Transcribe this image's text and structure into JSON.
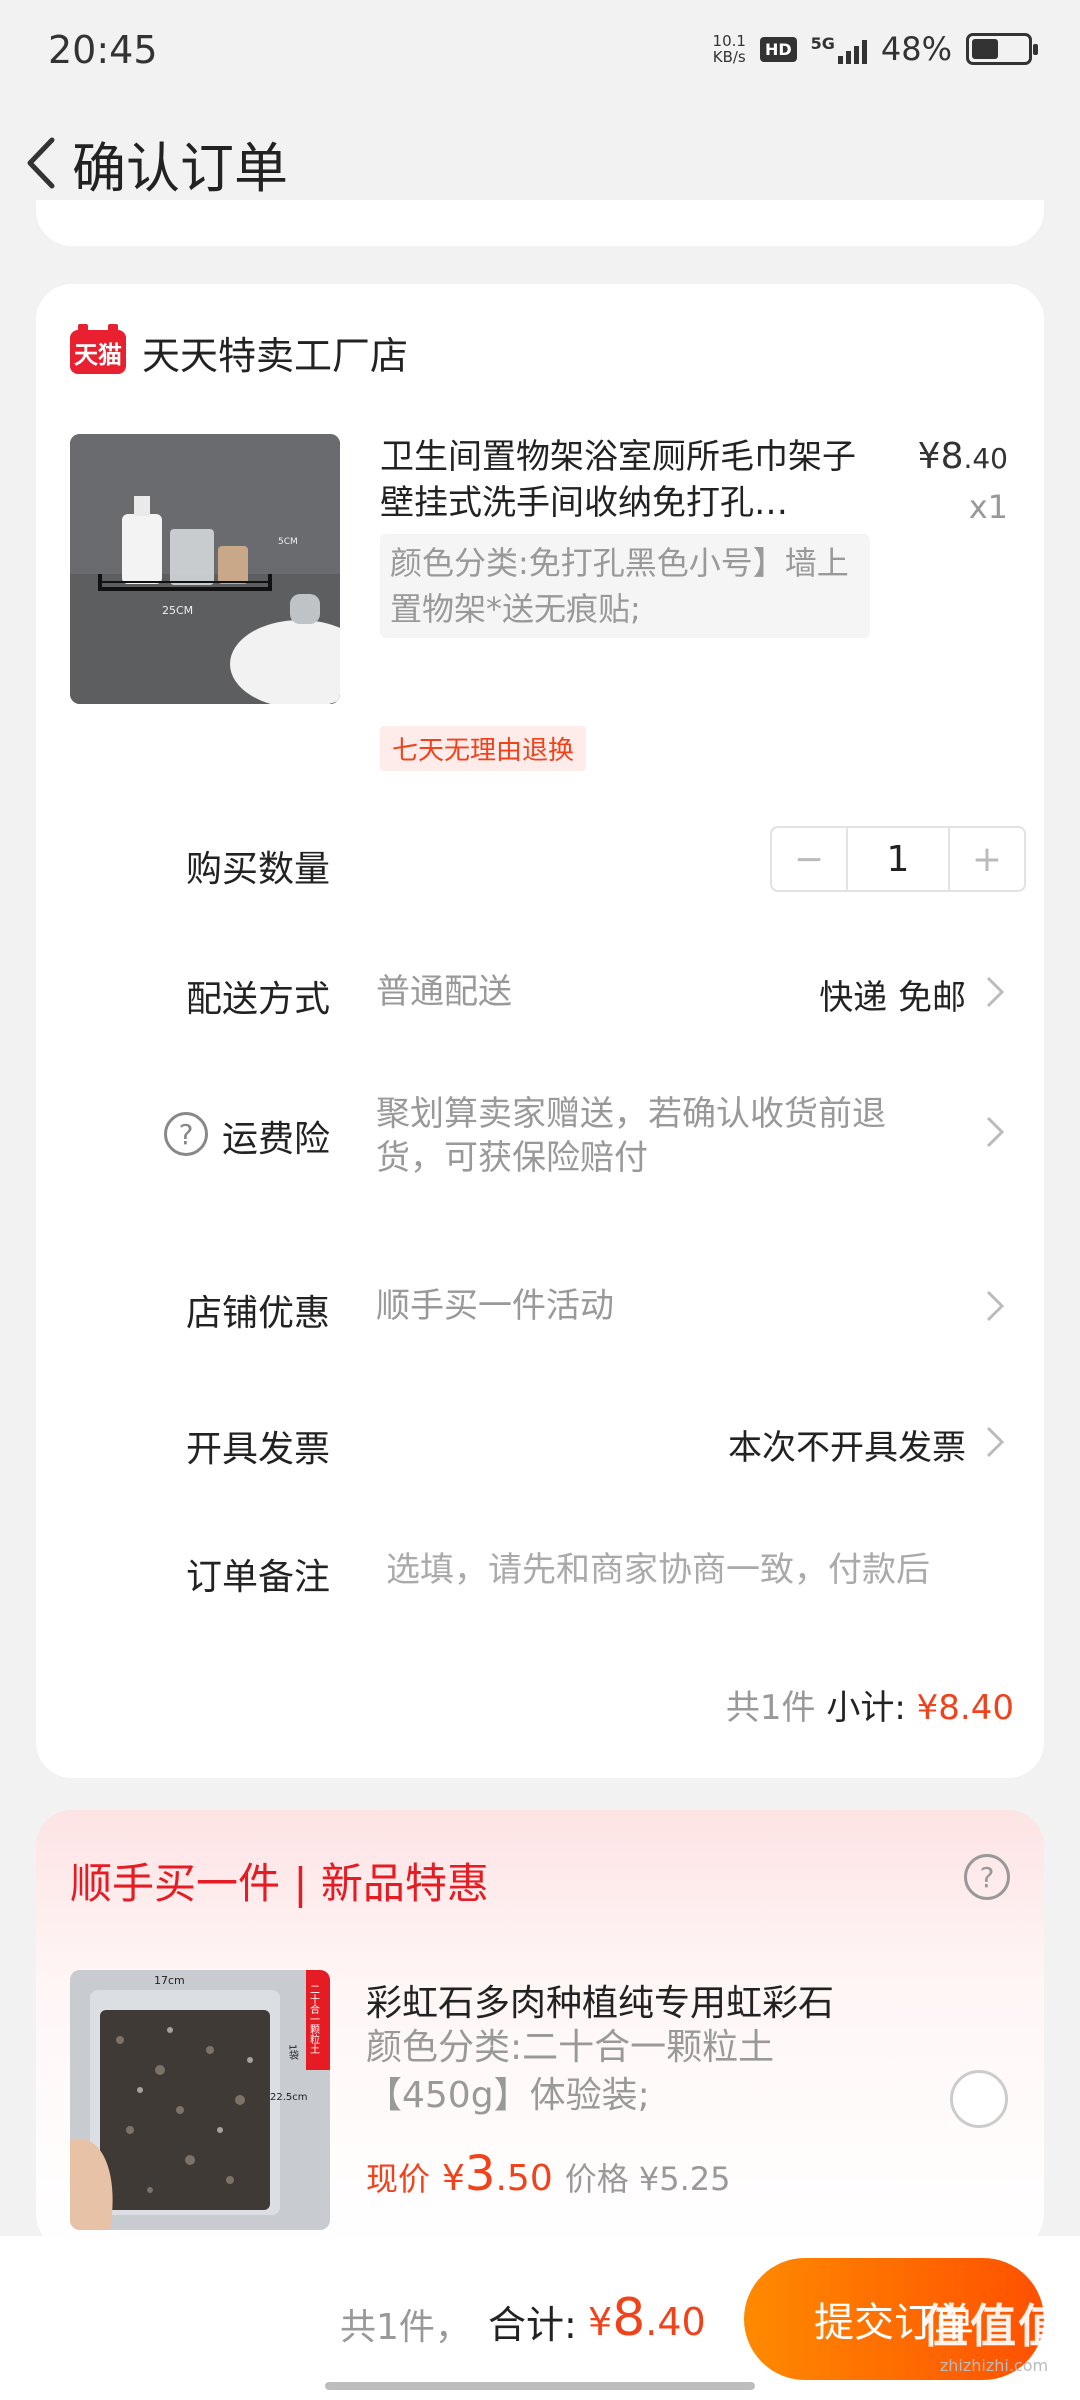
{
  "status_bar": {
    "time": "20:45",
    "net_speed_value": "10.1",
    "net_speed_unit": "KB/s",
    "hd": "HD",
    "network": "5G",
    "battery_pct": "48%",
    "battery_level": 0.48
  },
  "header": {
    "title": "确认订单"
  },
  "order": {
    "shop_badge": "天猫",
    "shop_name": "天天特卖工厂店",
    "product": {
      "title": "卫生间置物架浴室厕所毛巾架子壁挂式洗手间收纳免打孔…",
      "price_symbol": "¥",
      "price_int": "8",
      "price_dec": ".40",
      "qty": "x1",
      "spec": "颜色分类:免打孔黑色小号】墙上置物架*送无痕贴;",
      "tag": "七天无理由退换",
      "img_label_w": "25CM",
      "img_label_h": "5CM"
    },
    "quantity": {
      "label": "购买数量",
      "minus": "−",
      "value": "1",
      "plus": "+"
    },
    "delivery": {
      "label": "配送方式",
      "sub": "普通配送",
      "value": "快递 免邮"
    },
    "insurance": {
      "label": "运费险",
      "help": "?",
      "sub": "聚划算卖家赠送，若确认收货前退货，可获保险赔付"
    },
    "discount": {
      "label": "店铺优惠",
      "sub": "顺手买一件活动"
    },
    "invoice": {
      "label": "开具发票",
      "value": "本次不开具发票"
    },
    "note": {
      "label": "订单备注",
      "placeholder": "选填，请先和商家协商一致，付款后"
    },
    "summary": {
      "count": "共1件",
      "label": "小计:",
      "price": "¥8.40"
    }
  },
  "recommend": {
    "title": "顺手买一件 | 新品特惠",
    "help": "?",
    "name": "彩虹石多肉种植纯专用虹彩石",
    "spec": "颜色分类:二十合一颗粒土【450g】体验装;",
    "now_label": "现价",
    "now_symbol": "¥",
    "now_int": "3",
    "now_dec": ".50",
    "orig": "价格 ¥5.25",
    "img_label_w": "17cm",
    "img_label_h": "22.5cm",
    "img_tag": "二十合一颗粒土",
    "img_tag2": "1袋"
  },
  "bottom": {
    "count": "共1件，",
    "total_label": "合计:",
    "price_symbol": "¥",
    "price_int": "8",
    "price_dec": ".40",
    "submit": "提交订单"
  },
  "watermark": {
    "main": "值值值",
    "sub": "zhizhizhi.com"
  }
}
